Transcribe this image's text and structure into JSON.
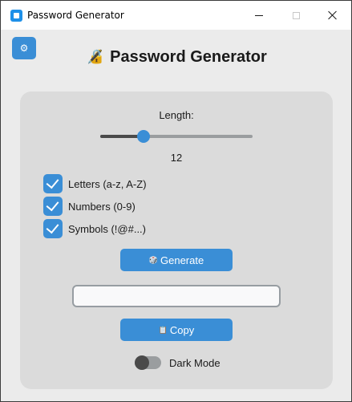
{
  "window": {
    "title": "Password Generator",
    "controls": {
      "minimize_icon": "minimize-icon",
      "maximize_icon": "maximize-icon",
      "close_icon": "close-icon"
    }
  },
  "settings_button": {
    "icon": "settings-icon"
  },
  "header": {
    "icon": "lock-key-icon",
    "title": "Password Generator"
  },
  "length": {
    "label": "Length:",
    "value": "12",
    "slider_min": 4,
    "slider_max": 32,
    "slider_value": 12
  },
  "options": [
    {
      "label": "Letters (a-z, A-Z)",
      "checked": true
    },
    {
      "label": "Numbers (0-9)",
      "checked": true
    },
    {
      "label": "Symbols (!@#...)",
      "checked": true
    }
  ],
  "generate_button": {
    "icon": "dice-icon",
    "label": "Generate"
  },
  "password_field": {
    "value": "",
    "placeholder": ""
  },
  "copy_button": {
    "icon": "clipboard-icon",
    "label": "Copy"
  },
  "dark_mode": {
    "label": "Dark Mode",
    "enabled": false
  },
  "colors": {
    "accent": "#3a8ed6",
    "window_bg": "#ebebeb",
    "panel_bg": "#dbdbdb",
    "text": "#1a1a1a"
  }
}
